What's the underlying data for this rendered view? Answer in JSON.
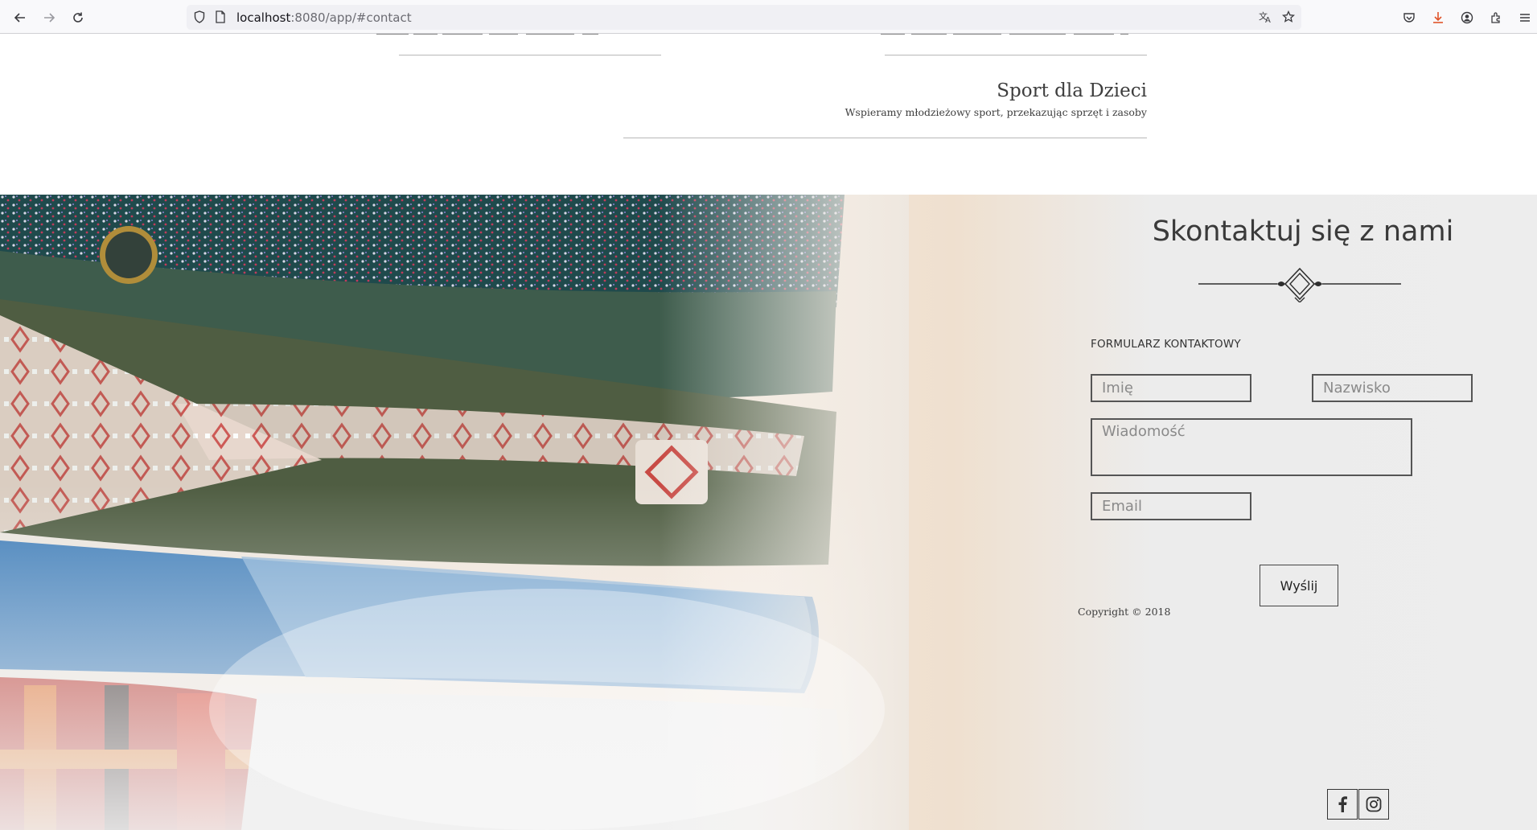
{
  "browser": {
    "url_host": "localhost",
    "url_rest": ":8080/app/#contact"
  },
  "services": {
    "title": "Sport dla Dzieci",
    "description": "Wspieramy młodzieżowy sport, przekazując sprzęt i zasoby"
  },
  "contact": {
    "title": "Skontaktuj się z nami",
    "form_heading": "FORMULARZ KONTAKTOWY",
    "first_name_placeholder": "Imię",
    "last_name_placeholder": "Nazwisko",
    "message_placeholder": "Wiadomość",
    "email_placeholder": "Email",
    "submit_label": "Wyślij",
    "copyright": "Copyright © 2018"
  },
  "social": {
    "facebook_label": "f",
    "facebook_icon": "facebook-icon",
    "instagram_icon": "instagram-icon"
  },
  "colors": {
    "text": "#333333",
    "border": "#555555",
    "chrome_bg": "#f9f9fb"
  }
}
